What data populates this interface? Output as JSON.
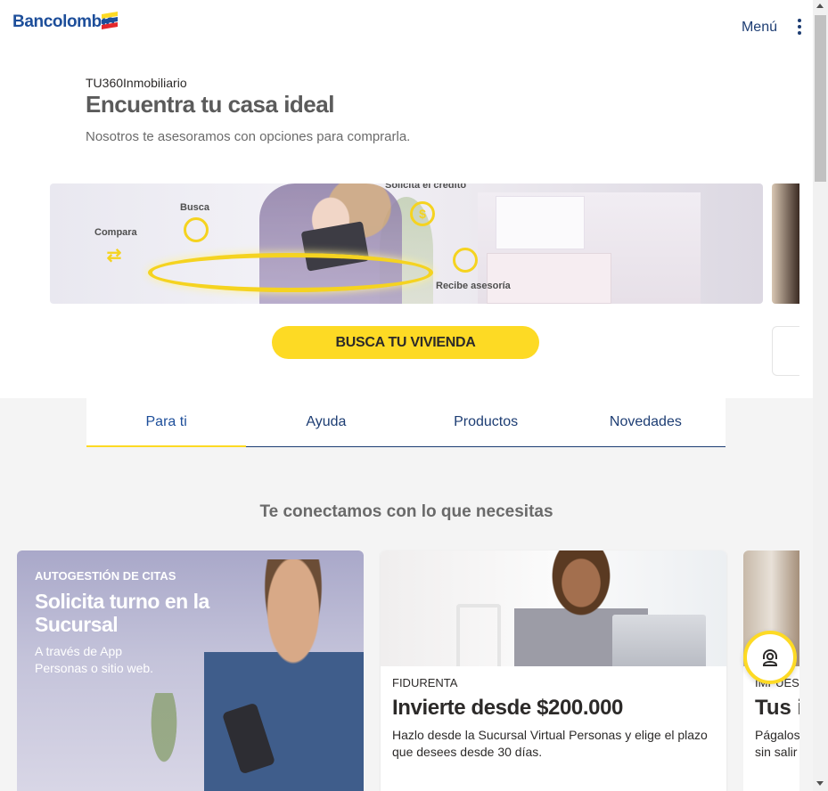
{
  "header": {
    "logo_text": "Bancolombia",
    "menu_label": "Menú"
  },
  "hero": {
    "kicker": "TU360Inmobiliario",
    "title": "Encuentra tu casa ideal",
    "subtitle": "Nosotros te asesoramos con opciones para comprarla."
  },
  "banner": {
    "labels": {
      "compara": "Compara",
      "busca": "Busca",
      "credito": "Solicita el crédito",
      "asesoria": "Recibe asesoría"
    },
    "cta_label": "BUSCA TU VIVIENDA"
  },
  "tabs": [
    {
      "label": "Para ti",
      "active": true
    },
    {
      "label": "Ayuda",
      "active": false
    },
    {
      "label": "Productos",
      "active": false
    },
    {
      "label": "Novedades",
      "active": false
    }
  ],
  "section": {
    "title": "Te conectamos con lo que necesitas"
  },
  "cards": [
    {
      "kicker": "AUTOGESTIÓN DE CITAS",
      "title": "Solicita turno en la Sucursal",
      "text": "A través de App Personas o sitio web."
    },
    {
      "kicker": "FIDURENTA",
      "title": "Invierte desde $200.000",
      "text": "Hazlo desde la Sucursal Virtual Personas y elige el plazo que desees desde 30 días."
    },
    {
      "kicker": "IMPUES",
      "title": "Tus i",
      "text_line1": "Págalos",
      "text_line2": "sin salir"
    }
  ],
  "colors": {
    "brand_blue": "#1d4e9a",
    "nav_blue": "#1d3d73",
    "accent_yellow": "#fdda24",
    "gray_bg": "#f4f4f4"
  },
  "icons": {
    "logo": "bancolombia-flag-icon",
    "menu": "kebab-menu-icon",
    "help": "headset-support-icon"
  }
}
